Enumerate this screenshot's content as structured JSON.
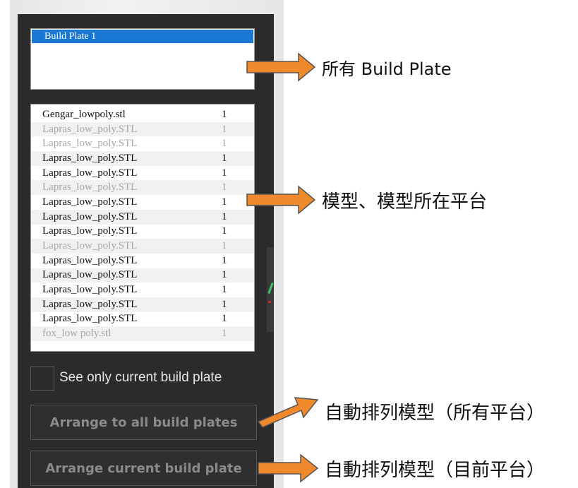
{
  "build_plates": {
    "items": [
      "Build Plate 1"
    ],
    "selected_index": 0
  },
  "models": [
    {
      "name": "Gengar_lowpoly.stl",
      "count": "1",
      "on_current_plate": true
    },
    {
      "name": "Lapras_low_poly.STL",
      "count": "1",
      "on_current_plate": false
    },
    {
      "name": "Lapras_low_poly.STL",
      "count": "1",
      "on_current_plate": false
    },
    {
      "name": "Lapras_low_poly.STL",
      "count": "1",
      "on_current_plate": true
    },
    {
      "name": "Lapras_low_poly.STL",
      "count": "1",
      "on_current_plate": true
    },
    {
      "name": "Lapras_low_poly.STL",
      "count": "1",
      "on_current_plate": false
    },
    {
      "name": "Lapras_low_poly.STL",
      "count": "1",
      "on_current_plate": true
    },
    {
      "name": "Lapras_low_poly.STL",
      "count": "1",
      "on_current_plate": true
    },
    {
      "name": "Lapras_low_poly.STL",
      "count": "1",
      "on_current_plate": true
    },
    {
      "name": "Lapras_low_poly.STL",
      "count": "1",
      "on_current_plate": false
    },
    {
      "name": "Lapras_low_poly.STL",
      "count": "1",
      "on_current_plate": true
    },
    {
      "name": "Lapras_low_poly.STL",
      "count": "1",
      "on_current_plate": true
    },
    {
      "name": "Lapras_low_poly.STL",
      "count": "1",
      "on_current_plate": true
    },
    {
      "name": "Lapras_low_poly.STL",
      "count": "1",
      "on_current_plate": true
    },
    {
      "name": "Lapras_low_poly.STL",
      "count": "1",
      "on_current_plate": true
    },
    {
      "name": "fox_low poly.stl",
      "count": "1",
      "on_current_plate": false
    }
  ],
  "see_only_current": {
    "label": "See only current build plate",
    "checked": false
  },
  "buttons": {
    "arrange_all": "Arrange to all build plates",
    "arrange_current": "Arrange current build plate"
  },
  "annotations": {
    "plates": "所有 Build Plate",
    "models": "模型、模型所在平台",
    "arrange_all": "自動排列模型（所有平台）",
    "arrange_current": "自動排列模型（目前平台）"
  },
  "colors": {
    "panel_bg": "#2b2b2b",
    "selection": "#1a78d4",
    "arrow_fill": "#f0892b",
    "arrow_stroke": "#555555",
    "inactive_text": "#a7a7a7"
  }
}
